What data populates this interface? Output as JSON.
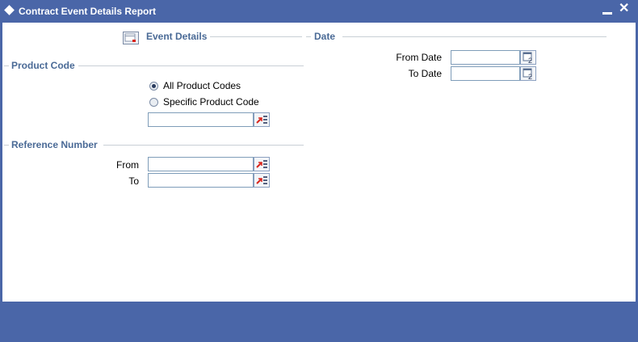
{
  "window": {
    "title": "Contract Event Details Report",
    "minimize_icon": "minimize-icon",
    "close_icon": "close-icon",
    "close_glyph": "✕"
  },
  "event_details": {
    "label": "Event Details",
    "icon": "event-details-icon"
  },
  "date_section": {
    "label": "Date",
    "from_label": "From Date",
    "to_label": "To Date",
    "from_value": "",
    "to_value": "",
    "calendar_icon": "calendar-icon"
  },
  "product_code": {
    "label": "Product Code",
    "options": [
      {
        "label": "All Product Codes",
        "selected": true
      },
      {
        "label": "Specific Product Code",
        "selected": false
      }
    ],
    "value": "",
    "lov_icon": "list-of-values-icon"
  },
  "reference_number": {
    "label": "Reference Number",
    "from_label": "From",
    "to_label": "To",
    "from_value": "",
    "to_value": "",
    "lov_icon": "list-of-values-icon"
  },
  "colors": {
    "titlebar": "#4a66a8",
    "legend_text": "#4a6a96",
    "lov_arrow": "#d9251c"
  }
}
